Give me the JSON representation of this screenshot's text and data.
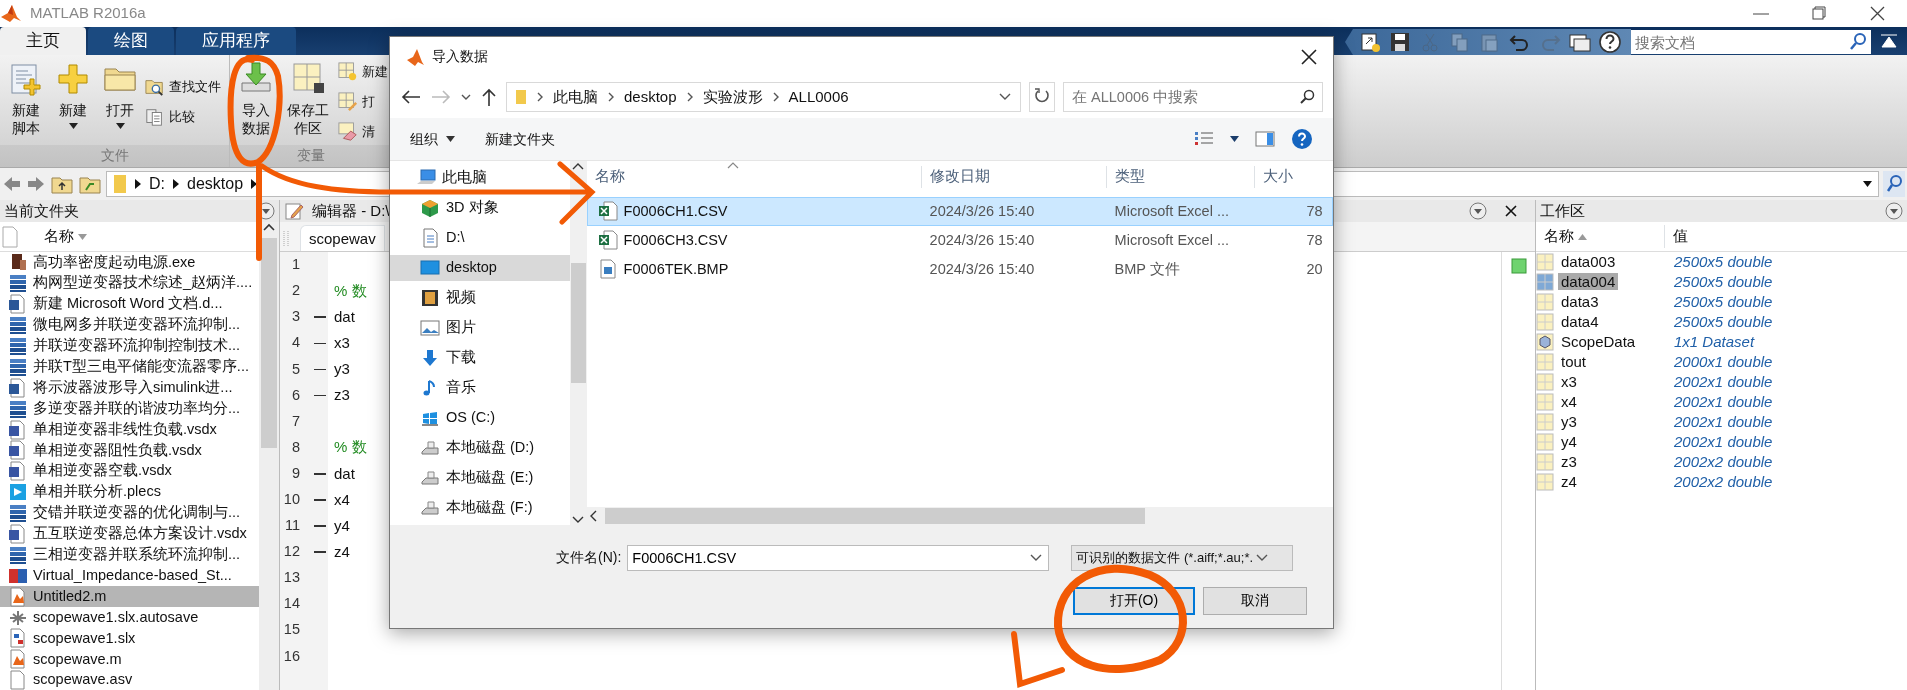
{
  "window": {
    "title": "MATLAB R2016a"
  },
  "ribbon_tabs": [
    {
      "label": "主页",
      "selected": true
    },
    {
      "label": "绘图",
      "selected": false
    },
    {
      "label": "应用程序",
      "selected": false
    }
  ],
  "quick_tools": [
    {
      "disabled": false
    },
    {
      "disabled": false
    },
    {
      "disabled": true
    },
    {
      "disabled": true
    },
    {
      "disabled": true
    },
    {
      "disabled": false
    },
    {
      "disabled": true
    },
    {
      "disabled": false
    },
    {
      "disabled": false
    }
  ],
  "doc_search": {
    "placeholder": "搜索文档"
  },
  "ribbon_groups": [
    {
      "label": "文件",
      "buttons": [
        {
          "kind": "large",
          "label": "新建脚本",
          "dropdown": false
        },
        {
          "kind": "large",
          "label": "新建",
          "dropdown": true
        },
        {
          "kind": "large",
          "label": "打开",
          "dropdown": true
        },
        {
          "kind": "small",
          "label": "查找文件"
        },
        {
          "kind": "small",
          "label": "比较"
        }
      ]
    },
    {
      "label": "变量",
      "buttons": [
        {
          "kind": "large",
          "label": "导入数据",
          "dropdown": false
        },
        {
          "kind": "large",
          "label": "保存工作区",
          "dropdown": false
        },
        {
          "kind": "small",
          "label": "新建"
        },
        {
          "kind": "small",
          "label": "打"
        },
        {
          "kind": "small",
          "label": "清"
        }
      ]
    }
  ],
  "address_bar": {
    "segments": [
      "D:",
      "desktop"
    ]
  },
  "current_folder": {
    "title": "当前文件夹",
    "column": "名称",
    "files": [
      {
        "name": "高功率密度起动电源.exe",
        "kind": "exe",
        "selected": false
      },
      {
        "name": "构网型逆变器技术综述_赵炳洋....",
        "kind": "stack",
        "selected": false
      },
      {
        "name": "新建 Microsoft Word 文档.d...",
        "kind": "word",
        "selected": false
      },
      {
        "name": "微电网多并联逆变器环流抑制...",
        "kind": "stack",
        "selected": false
      },
      {
        "name": "并联逆变器环流抑制控制技术...",
        "kind": "stack",
        "selected": false
      },
      {
        "name": "并联T型三电平储能变流器零序...",
        "kind": "stack",
        "selected": false
      },
      {
        "name": "将示波器波形导入simulink进...",
        "kind": "word",
        "selected": false
      },
      {
        "name": "多逆变器并联的谐波功率均分...",
        "kind": "stack",
        "selected": false
      },
      {
        "name": "单相逆变器非线性负载.vsdx",
        "kind": "visio",
        "selected": false
      },
      {
        "name": "单相逆变器阻性负载.vsdx",
        "kind": "visio",
        "selected": false
      },
      {
        "name": "单相逆变器空载.vsdx",
        "kind": "visio",
        "selected": false
      },
      {
        "name": "单相并联分析.plecs",
        "kind": "plecs",
        "selected": false
      },
      {
        "name": "交错并联逆变器的优化调制与...",
        "kind": "stack",
        "selected": false
      },
      {
        "name": "五互联逆变器总体方案设计.vsdx",
        "kind": "visio",
        "selected": false
      },
      {
        "name": "三相逆变器并联系统环流抑制...",
        "kind": "stack",
        "selected": false
      },
      {
        "name": "Virtual_Impedance-based_St...",
        "kind": "zy",
        "selected": false
      },
      {
        "name": "Untitled2.m",
        "kind": "script",
        "selected": true
      },
      {
        "name": "scopewave1.slx.autosave",
        "kind": "autosave",
        "selected": false
      },
      {
        "name": "scopewave1.slx",
        "kind": "model",
        "selected": false
      },
      {
        "name": "scopewave.m",
        "kind": "script",
        "selected": false
      },
      {
        "name": "scopewave.asv",
        "kind": "blank",
        "selected": false
      }
    ]
  },
  "editor": {
    "title": "编辑器 - D:\\",
    "tab": "scopewav",
    "lines": [
      {
        "number": "1",
        "executable": false
      },
      {
        "number": "2",
        "executable": false,
        "code": "% 数",
        "kind": "comment"
      },
      {
        "number": "3",
        "executable": true,
        "code": "dat",
        "kind": "code"
      },
      {
        "number": "4",
        "executable": true,
        "code": "x3",
        "kind": "code"
      },
      {
        "number": "5",
        "executable": true,
        "code": "y3",
        "kind": "code"
      },
      {
        "number": "6",
        "executable": true,
        "code": "z3",
        "kind": "code"
      },
      {
        "number": "7",
        "executable": false
      },
      {
        "number": "8",
        "executable": false,
        "code": "% 数",
        "kind": "comment"
      },
      {
        "number": "9",
        "executable": true,
        "code": "dat",
        "kind": "code"
      },
      {
        "number": "10",
        "executable": true,
        "code": "x4",
        "kind": "code"
      },
      {
        "number": "11",
        "executable": true,
        "code": "y4",
        "kind": "code"
      },
      {
        "number": "12",
        "executable": true,
        "code": "z4",
        "kind": "code"
      },
      {
        "number": "13",
        "executable": false
      },
      {
        "number": "14",
        "executable": false
      },
      {
        "number": "15",
        "executable": false
      },
      {
        "number": "16",
        "executable": false
      }
    ]
  },
  "workspace": {
    "title": "工作区",
    "columns": [
      "名称",
      "值"
    ],
    "variables": [
      {
        "name": "data003",
        "value": "2500x5 double",
        "kind": "matrix",
        "selected": false
      },
      {
        "name": "data004",
        "value": "2500x5 double",
        "kind": "matrix",
        "selected": true
      },
      {
        "name": "data3",
        "value": "2500x5 double",
        "kind": "matrix",
        "selected": false
      },
      {
        "name": "data4",
        "value": "2500x5 double",
        "kind": "matrix",
        "selected": false
      },
      {
        "name": "ScopeData",
        "value": "1x1 Dataset",
        "kind": "dataset",
        "selected": false
      },
      {
        "name": "tout",
        "value": "2000x1 double",
        "kind": "matrix",
        "selected": false
      },
      {
        "name": "x3",
        "value": "2002x1 double",
        "kind": "matrix",
        "selected": false
      },
      {
        "name": "x4",
        "value": "2002x1 double",
        "kind": "matrix",
        "selected": false
      },
      {
        "name": "y3",
        "value": "2002x1 double",
        "kind": "matrix",
        "selected": false
      },
      {
        "name": "y4",
        "value": "2002x1 double",
        "kind": "matrix",
        "selected": false
      },
      {
        "name": "z3",
        "value": "2002x2 double",
        "kind": "matrix",
        "selected": false
      },
      {
        "name": "z4",
        "value": "2002x2 double",
        "kind": "matrix",
        "selected": false
      }
    ]
  },
  "dialog": {
    "title": "导入数据",
    "path": [
      "此电脑",
      "desktop",
      "实验波形",
      "ALL0006"
    ],
    "search": {
      "placeholder": "在 ALL0006 中搜索"
    },
    "toolbar": [
      {
        "label": "组织",
        "dropdown": true
      },
      {
        "label": "新建文件夹",
        "dropdown": false
      }
    ],
    "nav": [
      {
        "label": "此电脑",
        "kind": "computer",
        "selected": false
      },
      {
        "label": "3D 对象",
        "kind": "cube",
        "selected": false
      },
      {
        "label": "D:\\",
        "kind": "document",
        "selected": false
      },
      {
        "label": "desktop",
        "kind": "desktop",
        "selected": true
      },
      {
        "label": "视频",
        "kind": "video",
        "selected": false
      },
      {
        "label": "图片",
        "kind": "pictures",
        "selected": false
      },
      {
        "label": "下载",
        "kind": "download",
        "selected": false
      },
      {
        "label": "音乐",
        "kind": "music",
        "selected": false
      },
      {
        "label": "OS (C:)",
        "kind": "system",
        "selected": false
      },
      {
        "label": "本地磁盘 (D:)",
        "kind": "drive",
        "selected": false
      },
      {
        "label": "本地磁盘 (E:)",
        "kind": "drive",
        "selected": false
      },
      {
        "label": "本地磁盘 (F:)",
        "kind": "drive",
        "selected": false
      }
    ],
    "columns": [
      "名称",
      "修改日期",
      "类型",
      "大小"
    ],
    "files": [
      {
        "name": "F0006CH1.CSV",
        "modified": "2024/3/26 15:40",
        "type": "Microsoft Excel ...",
        "size": "78",
        "kind": "spreadsheet",
        "selected": true
      },
      {
        "name": "F0006CH3.CSV",
        "modified": "2024/3/26 15:40",
        "type": "Microsoft Excel ...",
        "size": "78",
        "kind": "spreadsheet",
        "selected": false
      },
      {
        "name": "F0006TEK.BMP",
        "modified": "2024/3/26 15:40",
        "type": "BMP 文件",
        "size": "20",
        "kind": "image",
        "selected": false
      }
    ],
    "filename_label": "文件名(N):",
    "filename": "F0006CH1.CSV",
    "filter": "可识别的数据文件 (*.aiff;*.au;*.",
    "buttons": [
      {
        "label": "打开(O)",
        "default": true
      },
      {
        "label": "取消",
        "default": false
      }
    ]
  }
}
